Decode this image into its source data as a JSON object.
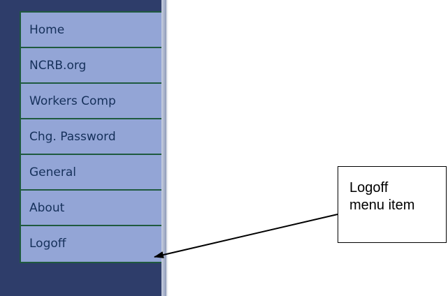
{
  "sidebar": {
    "items": [
      {
        "label": "Home"
      },
      {
        "label": "NCRB.org"
      },
      {
        "label": "Workers Comp"
      },
      {
        "label": "Chg. Password"
      },
      {
        "label": "General"
      },
      {
        "label": "About"
      },
      {
        "label": "Logoff"
      }
    ]
  },
  "callout": {
    "line1": "Logoff",
    "line2": "menu item"
  },
  "colors": {
    "sidebar_background": "#2e3d6a",
    "menu_item_background": "#93a5d6",
    "menu_border": "#1f5a3f",
    "menu_text": "#15305a"
  }
}
